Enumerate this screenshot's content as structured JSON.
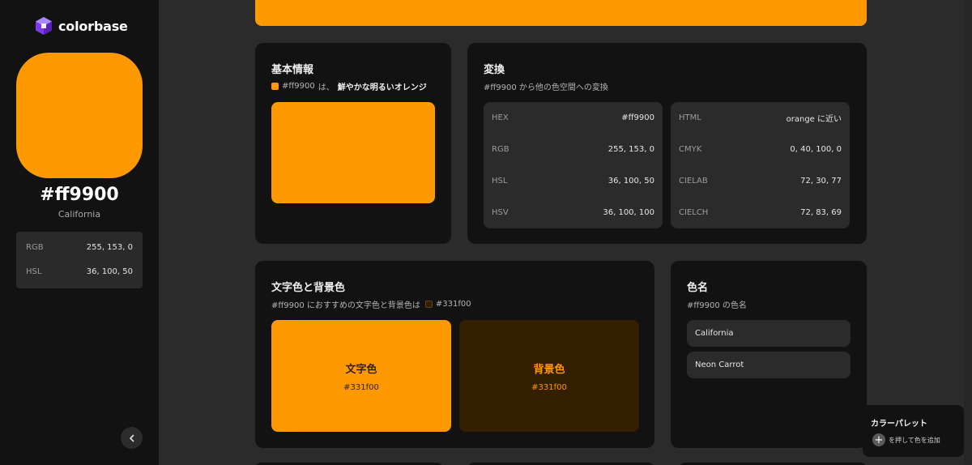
{
  "brand": {
    "name": "colorbase"
  },
  "colors": {
    "main": "#ff9900",
    "text_color": "#331f00",
    "background_color": "#331f00"
  },
  "sidebar": {
    "hex": "#ff9900",
    "name": "California",
    "values": [
      {
        "label": "RGB",
        "value": "255, 153, 0"
      },
      {
        "label": "HSL",
        "value": "36, 100, 50"
      }
    ]
  },
  "basic_info": {
    "title": "基本情報",
    "hex": "#ff9900",
    "desc_prefix": "は、",
    "desc_emphasis": "鮮やかな明るいオレンジ"
  },
  "conversion": {
    "title": "変換",
    "subtitle": "#ff9900 から他の色空間への変換",
    "left": [
      {
        "label": "HEX",
        "value": "#ff9900"
      },
      {
        "label": "RGB",
        "value": "255, 153, 0"
      },
      {
        "label": "HSL",
        "value": "36, 100, 50"
      },
      {
        "label": "HSV",
        "value": "36, 100, 100"
      }
    ],
    "right": [
      {
        "label": "HTML",
        "value": "orange に近い"
      },
      {
        "label": "CMYK",
        "value": "0, 40, 100, 0"
      },
      {
        "label": "CIELAB",
        "value": "72, 30, 77"
      },
      {
        "label": "CIELCH",
        "value": "72, 83, 69"
      }
    ]
  },
  "text_bg": {
    "title": "文字色と背景色",
    "subtitle_prefix": "#ff9900 におすすめの文字色と背景色は",
    "subtitle_hex": "#331f00",
    "text_label": "文字色",
    "text_code": "#331f00",
    "bg_label": "背景色",
    "bg_code": "#331f00"
  },
  "color_names": {
    "title": "色名",
    "subtitle": "#ff9900 の色名",
    "items": [
      "California",
      "Neon Carrot"
    ]
  },
  "palette": {
    "title": "カラーパレット",
    "hint": "を押して色を追加"
  },
  "icons": {
    "collapse": "chevron-left-icon",
    "add": "plus-icon"
  }
}
